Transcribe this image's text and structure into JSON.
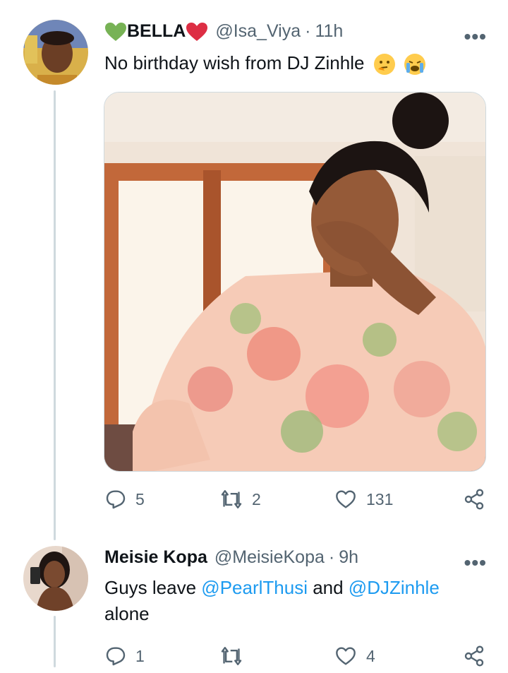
{
  "tweet1": {
    "name": "BELLA",
    "handle": "@Isa_Viya",
    "separator": "·",
    "time": "11h",
    "text": "No birthday wish from DJ Zinhle",
    "replies": "5",
    "retweets": "2",
    "likes": "131"
  },
  "tweet2": {
    "name": "Meisie Kopa",
    "handle": "@MeisieKopa",
    "separator": "·",
    "time": "9h",
    "text_prefix": "Guys leave ",
    "mention1": "@PearlThusi",
    "text_mid": " and ",
    "mention2": "@DJZinhle",
    "text_line2": "alone",
    "replies": "1",
    "retweets": "",
    "likes": "4"
  },
  "more_label": "•••",
  "colors": {
    "accent": "#1d9bf0",
    "muted": "#536471",
    "heart": "#e0245e",
    "green_heart": "#77b255"
  },
  "icons": [
    "green-heart-icon",
    "red-heart-icon",
    "thinking-face-icon",
    "crying-face-icon",
    "reply-icon",
    "retweet-icon",
    "like-icon",
    "share-icon",
    "more-icon"
  ]
}
